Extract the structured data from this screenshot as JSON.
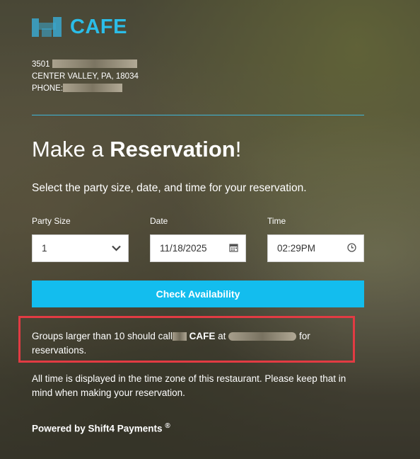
{
  "brand": {
    "name": "CAFE",
    "logo_color": "#2bbde8"
  },
  "address": {
    "line1_prefix": "3501",
    "line2": "CENTER VALLEY, PA, 18034",
    "phone_label": "PHONE:"
  },
  "heading": {
    "prefix": "Make a ",
    "bold": "Reservation",
    "suffix": "!"
  },
  "subtitle": "Select the party size, date, and time for your reservation.",
  "form": {
    "party_size": {
      "label": "Party Size",
      "value": "1",
      "icon": "chevron-down-icon"
    },
    "date": {
      "label": "Date",
      "value": "11/18/2025",
      "icon": "calendar-icon"
    },
    "time": {
      "label": "Time",
      "value": "02:29PM",
      "icon": "clock-icon"
    }
  },
  "check_button": "Check Availability",
  "notice": {
    "before": "Groups larger than 10 should call",
    "brand": "CAFE",
    "at": "at",
    "after": "for reservations.",
    "highlight_color": "#e23b43"
  },
  "timezone_note": "All time is displayed in the time zone of this restaurant. Please keep that in mind when making your reservation.",
  "powered_by": "Powered by Shift4 Payments",
  "powered_mark": "®",
  "accent_color": "#13bdee"
}
